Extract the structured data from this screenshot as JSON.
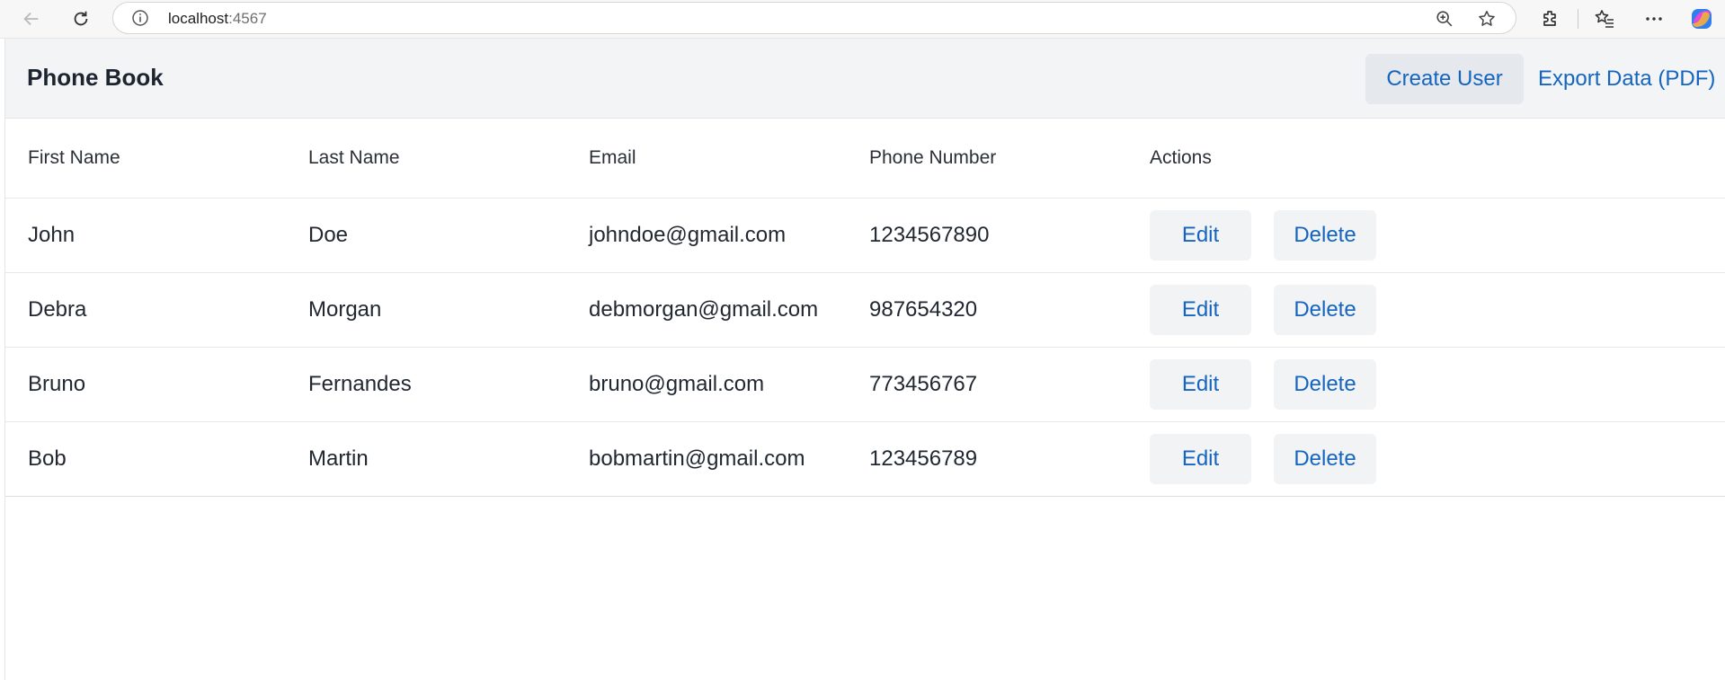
{
  "browser": {
    "url_host": "localhost",
    "url_port": ":4567"
  },
  "app": {
    "title": "Phone Book",
    "create_label": "Create User",
    "export_label": "Export Data (PDF)"
  },
  "table": {
    "headers": [
      "First Name",
      "Last Name",
      "Email",
      "Phone Number",
      "Actions"
    ],
    "edit_label": "Edit",
    "delete_label": "Delete",
    "rows": [
      {
        "first": "John",
        "last": "Doe",
        "email": "johndoe@gmail.com",
        "phone": "1234567890"
      },
      {
        "first": "Debra",
        "last": "Morgan",
        "email": "debmorgan@gmail.com",
        "phone": "987654320"
      },
      {
        "first": "Bruno",
        "last": "Fernandes",
        "email": "bruno@gmail.com",
        "phone": "773456767"
      },
      {
        "first": "Bob",
        "last": "Martin",
        "email": "bobmartin@gmail.com",
        "phone": "123456789"
      }
    ]
  },
  "colors": {
    "accent": "#1565c0",
    "header_bg": "#f3f4f6",
    "button_bg": "#f1f3f5"
  }
}
